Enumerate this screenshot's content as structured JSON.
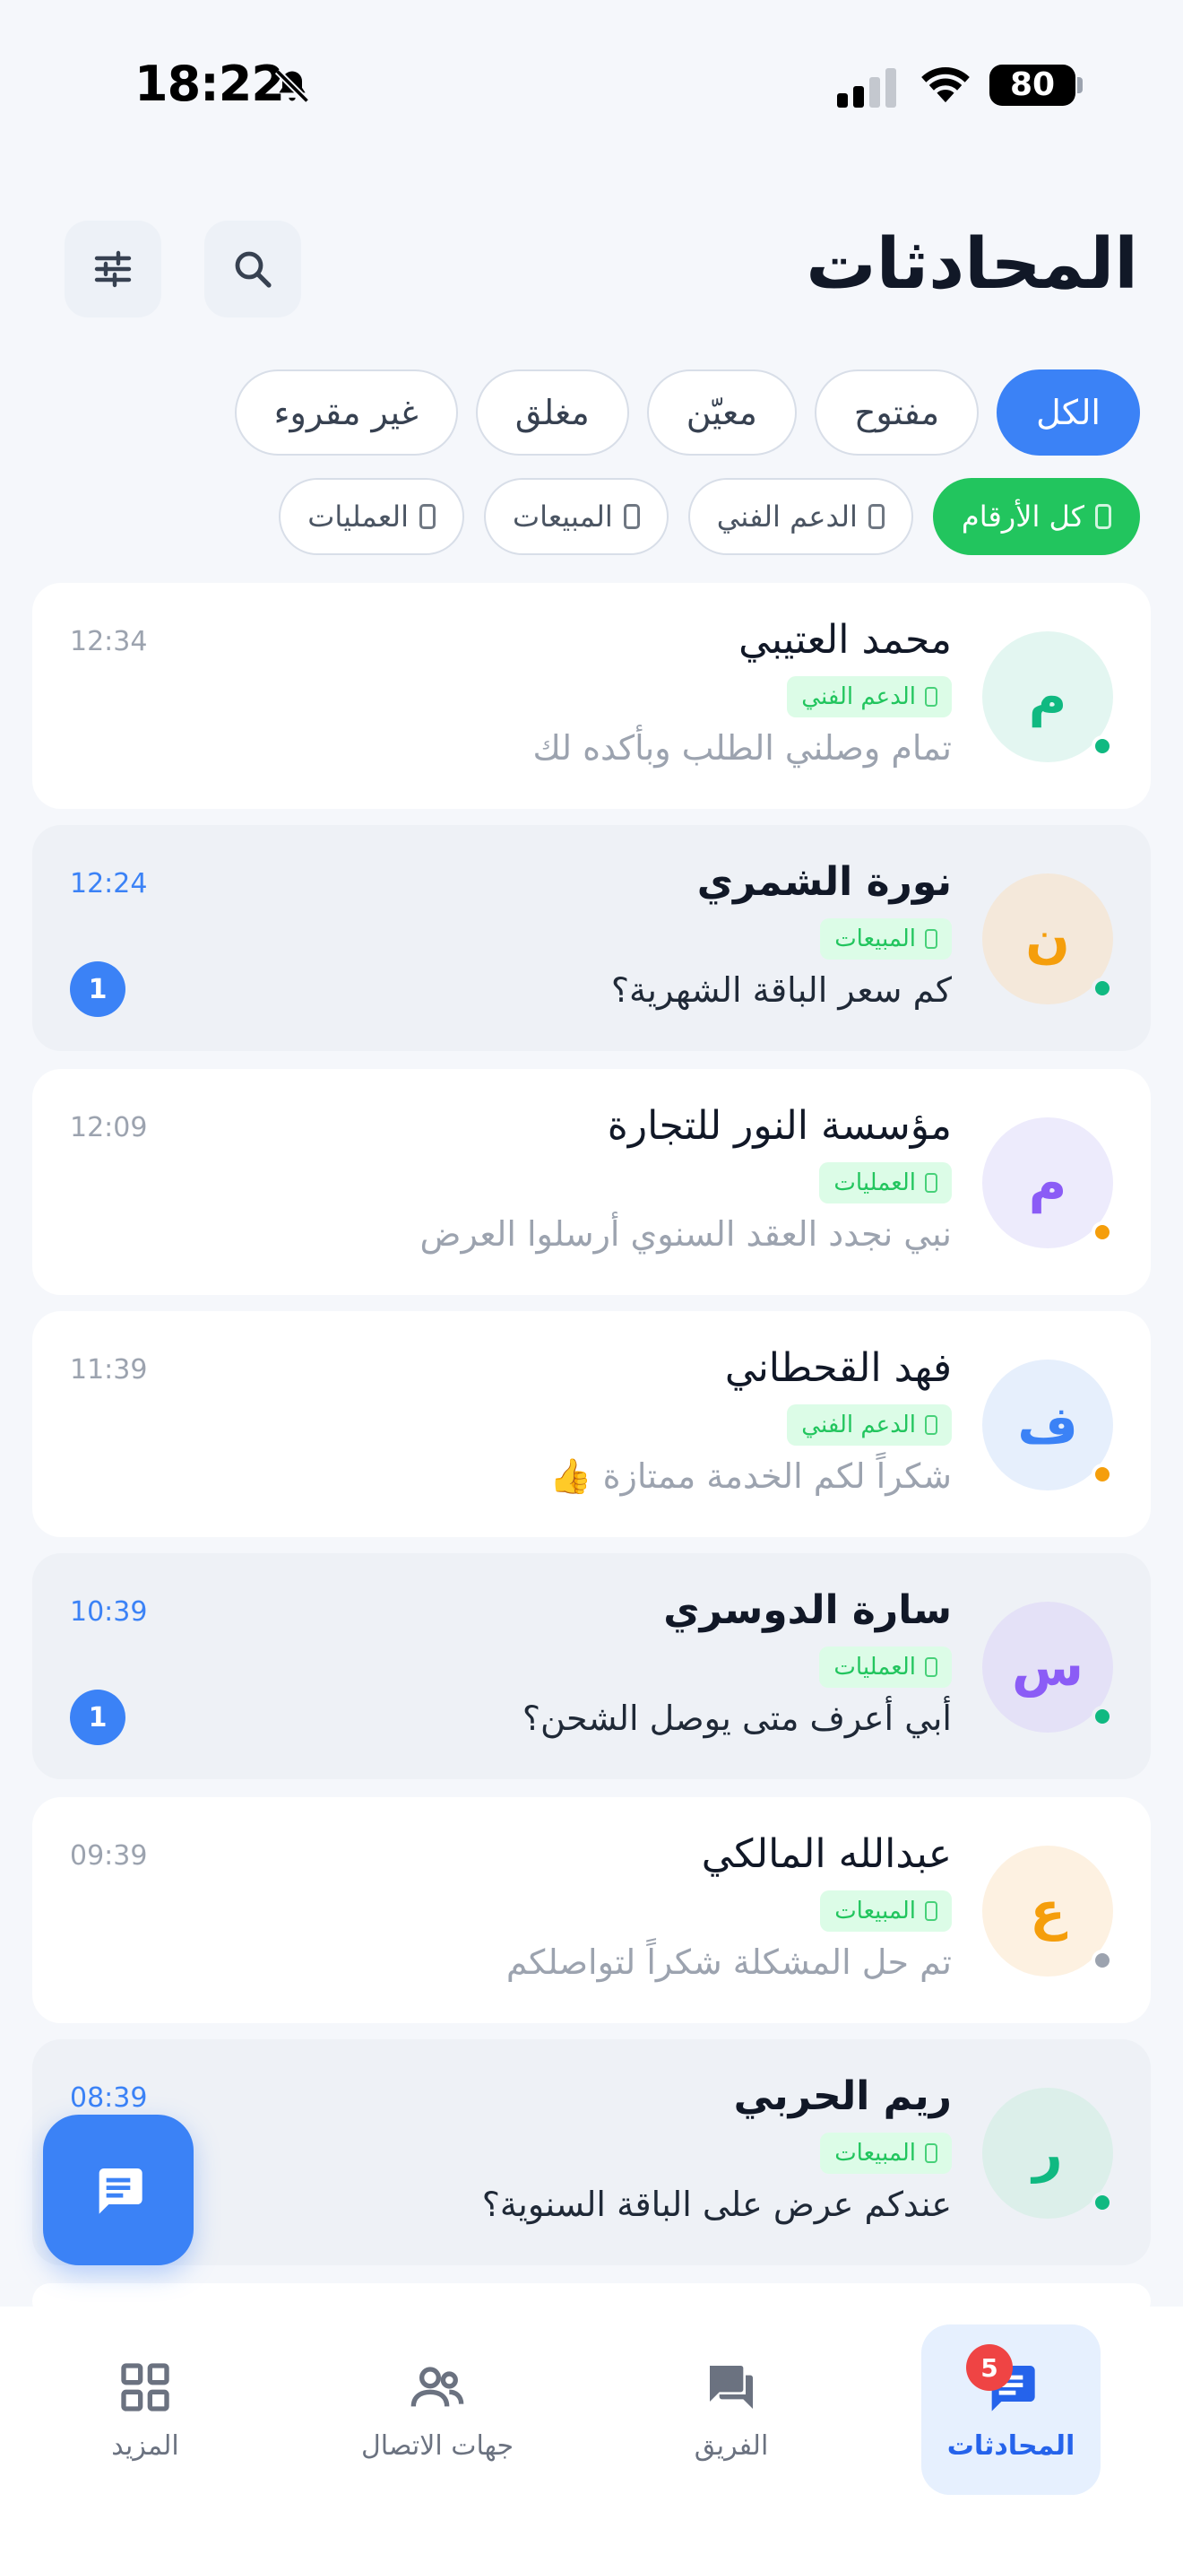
{
  "status_bar": {
    "time": "18:22",
    "battery": "80"
  },
  "header": {
    "title": "المحادثات"
  },
  "filters": {
    "status": [
      {
        "label": "الكل",
        "active": true
      },
      {
        "label": "مفتوح",
        "active": false
      },
      {
        "label": "معيّن",
        "active": false
      },
      {
        "label": "مغلق",
        "active": false
      },
      {
        "label": "غير مقروء",
        "active": false
      }
    ],
    "lines": [
      {
        "label": "كل الأرقام",
        "active": true
      },
      {
        "label": "الدعم الفني",
        "active": false
      },
      {
        "label": "المبيعات",
        "active": false
      },
      {
        "label": "العمليات",
        "active": false
      }
    ]
  },
  "conversations": [
    {
      "initial": "م",
      "name": "محمد العتيبي",
      "tag": "الدعم الفني",
      "preview": "تمام وصلني الطلب وبأكده لك",
      "time": "12:34",
      "unread": false,
      "unread_count": "",
      "avatar_bg": "#E3F6F1",
      "avatar_fg": "#10B981",
      "presence": "#10B981"
    },
    {
      "initial": "ن",
      "name": "نورة الشمري",
      "tag": "المبيعات",
      "preview": "كم سعر الباقة الشهرية؟",
      "time": "12:24",
      "unread": true,
      "unread_count": "1",
      "avatar_bg": "#F4E8DA",
      "avatar_fg": "#F59E0B",
      "presence": "#10B981"
    },
    {
      "initial": "م",
      "name": "مؤسسة النور للتجارة",
      "tag": "العمليات",
      "preview": "نبي نجدد العقد السنوي أرسلوا العرض",
      "time": "12:09",
      "unread": false,
      "unread_count": "",
      "avatar_bg": "#EDEBFC",
      "avatar_fg": "#8B5CF6",
      "presence": "#F59E0B"
    },
    {
      "initial": "ف",
      "name": "فهد القحطاني",
      "tag": "الدعم الفني",
      "preview": "شكراً لكم الخدمة ممتازة 👍",
      "time": "11:39",
      "unread": false,
      "unread_count": "",
      "avatar_bg": "#E6EFFC",
      "avatar_fg": "#3B82F6",
      "presence": "#F59E0B"
    },
    {
      "initial": "س",
      "name": "سارة الدوسري",
      "tag": "العمليات",
      "preview": "أبي أعرف متى يوصل الشحن؟",
      "time": "10:39",
      "unread": true,
      "unread_count": "1",
      "avatar_bg": "#E4E1F7",
      "avatar_fg": "#8B5CF6",
      "presence": "#10B981"
    },
    {
      "initial": "ع",
      "name": "عبدالله المالكي",
      "tag": "المبيعات",
      "preview": "تم حل المشكلة شكراً لتواصلكم",
      "time": "09:39",
      "unread": false,
      "unread_count": "",
      "avatar_bg": "#FDF1E1",
      "avatar_fg": "#F59E0B",
      "presence": "#9CA3AF"
    },
    {
      "initial": "ر",
      "name": "ريم الحربي",
      "tag": "المبيعات",
      "preview": "عندكم عرض على الباقة السنوية؟",
      "time": "08:39",
      "unread": true,
      "unread_count": "",
      "avatar_bg": "#DCEFEA",
      "avatar_fg": "#10B981",
      "presence": "#10B981"
    }
  ],
  "bottom_nav": {
    "conversations": {
      "label": "المحادثات",
      "badge": "5"
    },
    "team": {
      "label": "الفريق"
    },
    "contacts": {
      "label": "جهات الاتصال"
    },
    "more": {
      "label": "المزيد"
    }
  },
  "colors": {
    "primary": "#3B82F6",
    "success": "#22C55E",
    "unread_row": "#EEF1F6"
  }
}
